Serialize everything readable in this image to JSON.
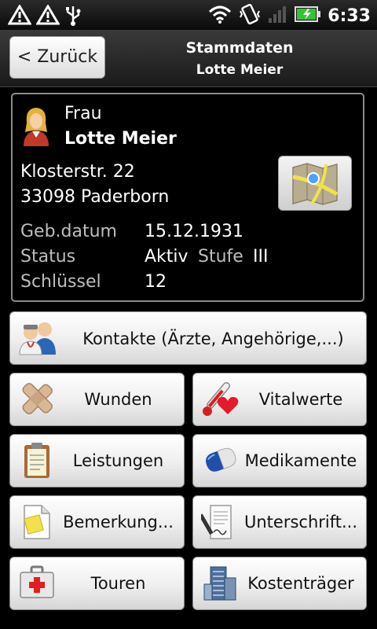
{
  "statusbar": {
    "time": "6:33",
    "icons": [
      "warning-icon",
      "warning-icon",
      "usb-icon",
      "wifi-icon",
      "vibrate-icon",
      "signal-icon",
      "battery-charging-icon"
    ]
  },
  "header": {
    "back_label": "< Zurück",
    "title": "Stammdaten",
    "subtitle": "Lotte Meier"
  },
  "patient": {
    "salutation": "Frau",
    "name": "Lotte Meier",
    "street": "Klosterstr. 22",
    "city": "33098 Paderborn",
    "birthdate_label": "Geb.datum",
    "birthdate": "15.12.1931",
    "status_label": "Status",
    "status": "Aktiv",
    "stufe_label": "Stufe",
    "stufe": "III",
    "key_label": "Schlüssel",
    "key": "12"
  },
  "menu": {
    "contacts": "Kontakte (Ärzte, Angehörige,...)",
    "wounds": "Wunden",
    "vitals": "Vitalwerte",
    "services": "Leistungen",
    "medications": "Medikamente",
    "remarks": "Bemerkung...",
    "signatures": "Unterschrift...",
    "tours": "Touren",
    "cost_bearer": "Kostenträger"
  },
  "colors": {
    "background": "#000000",
    "button_top": "#ffffff",
    "button_bottom": "#d6d6d6",
    "label_gray": "#bdbdbd",
    "battery_green": "#36c236"
  }
}
